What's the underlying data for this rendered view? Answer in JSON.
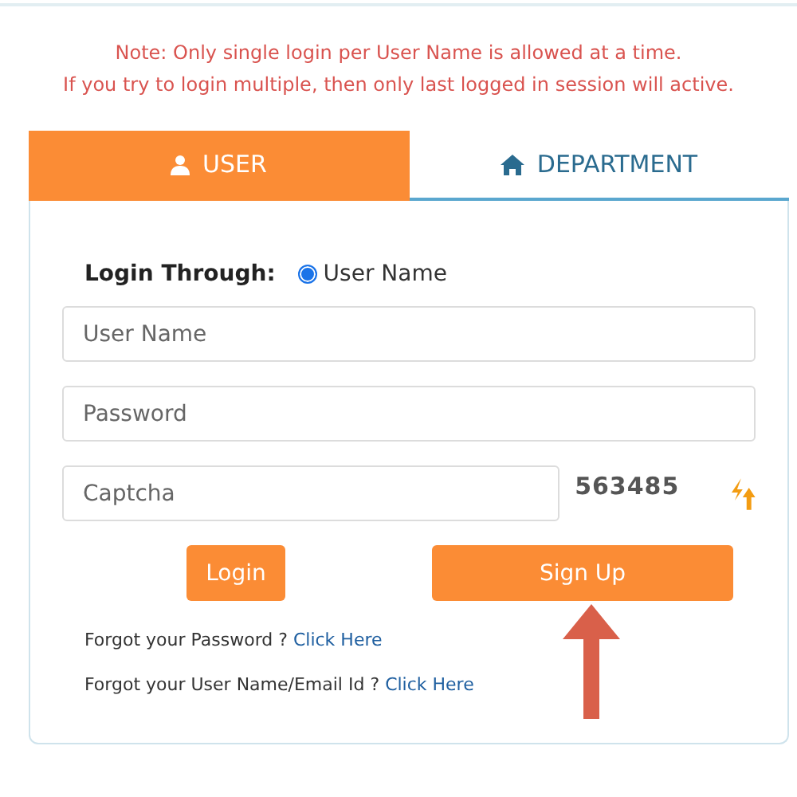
{
  "note": [
    "Note: Only single login per User Name is allowed at a time.",
    "If you try to login multiple, then only last logged in session will active."
  ],
  "tabs": [
    {
      "label": "USER",
      "selected": true
    },
    {
      "label": "DEPARTMENT",
      "selected": false
    }
  ],
  "login_through": {
    "label": "Login Through:",
    "options": [
      {
        "label": "User Name",
        "selected": true
      }
    ]
  },
  "fields": [
    {
      "placeholder": "User Name"
    },
    {
      "placeholder": "Password"
    }
  ],
  "captcha": {
    "placeholder": "Captcha",
    "code": "563485"
  },
  "buttons": [
    {
      "label": "Login",
      "kind": "small"
    },
    {
      "label": "Sign Up",
      "kind": "wide"
    }
  ],
  "help_links": [
    {
      "text": "Forgot your Password ?",
      "link": "Click Here"
    },
    {
      "text": "Forgot your User Name/Email Id ?",
      "link": "Click Here"
    }
  ],
  "annotation": {
    "kind": "arrow"
  }
}
